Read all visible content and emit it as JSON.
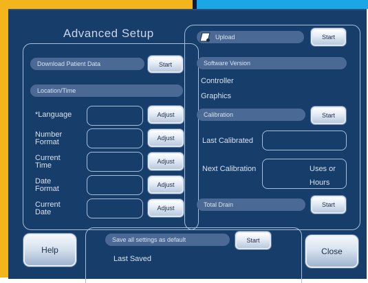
{
  "title": "Advanced Setup",
  "left": {
    "download_label": "Download Patient Data",
    "download_button": "Start",
    "location_header": "Location/Time",
    "rows": [
      {
        "label_line1": "*Language",
        "label_line2": "",
        "button": "Adjust"
      },
      {
        "label_line1": "Number",
        "label_line2": "Format",
        "button": "Adjust"
      },
      {
        "label_line1": "Current",
        "label_line2": "Time",
        "button": "Adjust"
      },
      {
        "label_line1": "Date",
        "label_line2": "Format",
        "button": "Adjust"
      },
      {
        "label_line1": "Current",
        "label_line2": "Date",
        "button": "Adjust"
      }
    ]
  },
  "right": {
    "upload_label": "Upload",
    "upload_button": "Start",
    "software_version": "Software Version",
    "controller": "Controller",
    "graphics": "Graphics",
    "calibration": "Calibration",
    "calibration_button": "Start",
    "last_calibrated": "Last Calibrated",
    "next_calibration": "Next Calibration",
    "uses_or": "Uses or",
    "hours": "Hours",
    "total_drain": "Total Drain",
    "total_drain_button": "Start"
  },
  "bottom": {
    "help": "Help",
    "save_default": "Save all settings as default",
    "save_button": "Start",
    "last_saved": "Last Saved",
    "close": "Close"
  }
}
